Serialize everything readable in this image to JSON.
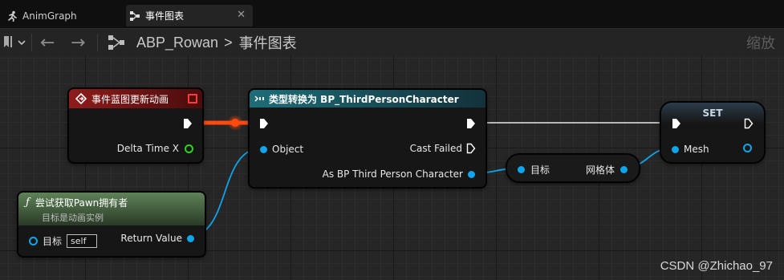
{
  "tabs": [
    {
      "label": "AnimGraph",
      "icon": "runner-icon"
    },
    {
      "label": "事件图表",
      "icon": "graph-icon",
      "close": "✕"
    }
  ],
  "toolbar": {
    "back": "←",
    "forward": "→",
    "breadcrumb_root": "ABP_Rowan",
    "breadcrumb_sep": ">",
    "breadcrumb_current": "事件图表",
    "zoom_label": "缩放"
  },
  "nodes": {
    "event": {
      "title": "事件蓝图更新动画",
      "output": "Delta Time X",
      "header_color": "#7a1414"
    },
    "cast": {
      "title": "类型转换为 BP_ThirdPersonCharacter",
      "input_object": "Object",
      "cast_failed": "Cast Failed",
      "as_output": "As BP Third Person Character",
      "header_color": "#1f6571"
    },
    "mesh_getter": {
      "input": "目标",
      "output": "网格体"
    },
    "set": {
      "title": "SET",
      "input": "Mesh"
    },
    "try_get_pawn": {
      "title": "尝试获取Pawn拥有者",
      "subtitle": "目标是动画实例",
      "target_label": "目标",
      "target_value": "self",
      "return_label": "Return Value",
      "header_color": "#4e6b48"
    }
  },
  "watermark": "CSDN @Zhichao_97"
}
